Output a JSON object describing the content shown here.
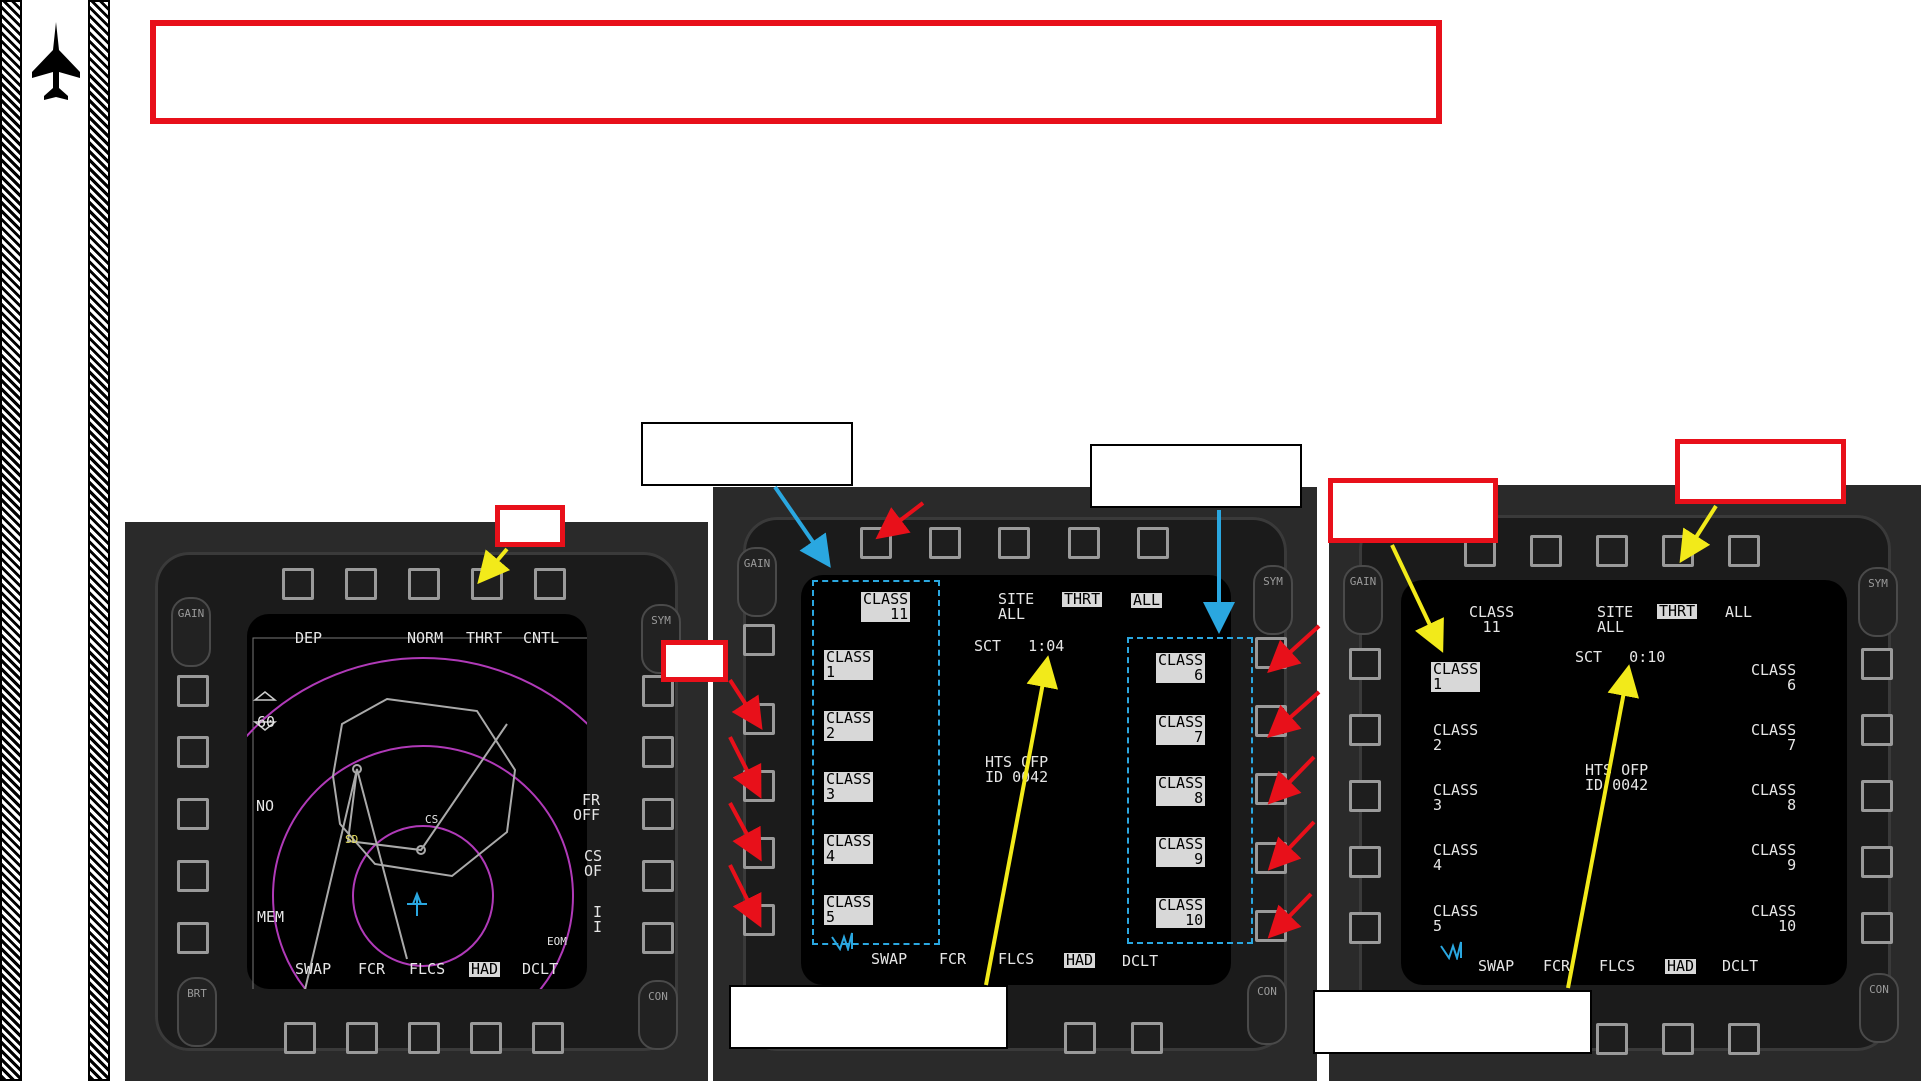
{
  "left_mfd": {
    "top_labels": [
      "DEP",
      "NORM",
      "THRT",
      "CNTL"
    ],
    "bottom_labels": [
      {
        "text": "SWAP",
        "highlight": false
      },
      {
        "text": "FCR",
        "highlight": false
      },
      {
        "text": "FLCS",
        "highlight": false
      },
      {
        "text": "HAD",
        "highlight": true
      },
      {
        "text": "DCLT",
        "highlight": false
      }
    ],
    "range_value": "60",
    "no_label": "NO",
    "mem_label": "MEM",
    "fr_off": "FR\nOFF",
    "cs_of": "CS\nOF",
    "i_label": "I\nI",
    "eom_label": "EOM",
    "cs_target": "CS",
    "sd_target": "SD",
    "gain": "GAIN",
    "sym": "SYM",
    "brt": "BRT",
    "con": "CON"
  },
  "mid_mfd": {
    "class11": "CLASS\n11",
    "site_all": "SITE\nALL",
    "thrt": "THRT",
    "all": "ALL",
    "sct": "SCT   1:04",
    "hts": "HTS OFP\nID 0042",
    "left_classes": [
      "CLASS\n1",
      "CLASS\n2",
      "CLASS\n3",
      "CLASS\n4",
      "CLASS\n5"
    ],
    "right_classes": [
      "CLASS\n6",
      "CLASS\n7",
      "CLASS\n8",
      "CLASS\n9",
      "CLASS\n10"
    ],
    "bottom_labels": [
      {
        "text": "SWAP",
        "highlight": false
      },
      {
        "text": "FCR",
        "highlight": false
      },
      {
        "text": "FLCS",
        "highlight": false
      },
      {
        "text": "HAD",
        "highlight": true
      },
      {
        "text": "DCLT",
        "highlight": false
      }
    ],
    "gain": "GAIN",
    "sym": "SYM",
    "con": "CON"
  },
  "right_mfd": {
    "class11": "CLASS\n11",
    "site_all": "SITE\nALL",
    "thrt": "THRT",
    "all": "ALL",
    "sct": "SCT   0:10",
    "hts": "HTS OFP\nID 0042",
    "left_classes": [
      "CLASS\n1",
      "CLASS\n2",
      "CLASS\n3",
      "CLASS\n4",
      "CLASS\n5"
    ],
    "right_classes": [
      "CLASS\n6",
      "CLASS\n7",
      "CLASS\n8",
      "CLASS\n9",
      "CLASS\n10"
    ],
    "bottom_labels": [
      {
        "text": "SWAP",
        "highlight": false
      },
      {
        "text": "FCR",
        "highlight": false
      },
      {
        "text": "FLCS",
        "highlight": false
      },
      {
        "text": "HAD",
        "highlight": true
      },
      {
        "text": "DCLT",
        "highlight": false
      }
    ],
    "gain": "GAIN",
    "sym": "SYM",
    "con": "CON"
  },
  "colors": {
    "callout_red": "#e8101a",
    "arrow_blue": "#2aa7e0",
    "arrow_yellow": "#f2ea1a",
    "symbology_purple": "#b03ab8"
  }
}
